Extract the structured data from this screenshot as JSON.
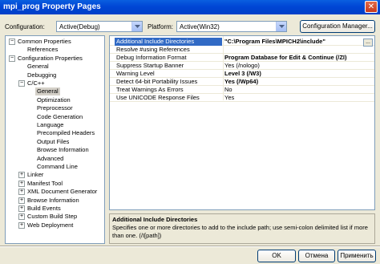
{
  "window": {
    "title": "mpi_prog Property Pages",
    "close_glyph": "✕"
  },
  "toolbar": {
    "configuration_label": "Configuration:",
    "configuration_value": "Active(Debug)",
    "platform_label": "Platform:",
    "platform_value": "Active(Win32)",
    "config_manager_label": "Configuration Manager..."
  },
  "tree": [
    {
      "label": "Common Properties",
      "toggle": "−"
    },
    {
      "label": "References"
    },
    {
      "label": "Configuration Properties",
      "toggle": "−"
    },
    {
      "label": "General"
    },
    {
      "label": "Debugging"
    },
    {
      "label": "C/C++",
      "toggle": "−"
    },
    {
      "label": "General",
      "selected": true
    },
    {
      "label": "Optimization"
    },
    {
      "label": "Preprocessor"
    },
    {
      "label": "Code Generation"
    },
    {
      "label": "Language"
    },
    {
      "label": "Precompiled Headers"
    },
    {
      "label": "Output Files"
    },
    {
      "label": "Browse Information"
    },
    {
      "label": "Advanced"
    },
    {
      "label": "Command Line"
    },
    {
      "label": "Linker",
      "toggle": "+"
    },
    {
      "label": "Manifest Tool",
      "toggle": "+"
    },
    {
      "label": "XML Document Generator",
      "toggle": "+"
    },
    {
      "label": "Browse Information",
      "toggle": "+"
    },
    {
      "label": "Build Events",
      "toggle": "+"
    },
    {
      "label": "Custom Build Step",
      "toggle": "+"
    },
    {
      "label": "Web Deployment",
      "toggle": "+"
    }
  ],
  "properties": [
    {
      "name": "Additional Include Directories",
      "value": "\"C:\\Program Files\\MPICH2\\include\"",
      "bold": true,
      "selected": true
    },
    {
      "name": "Resolve #using References",
      "value": ""
    },
    {
      "name": "Debug Information Format",
      "value": "Program Database for Edit & Continue (/ZI)",
      "bold": true
    },
    {
      "name": "Suppress Startup Banner",
      "value": "Yes (/nologo)"
    },
    {
      "name": "Warning Level",
      "value": "Level 3 (/W3)",
      "bold": true
    },
    {
      "name": "Detect 64-bit Portability Issues",
      "value": "Yes (/Wp64)",
      "bold": true
    },
    {
      "name": "Treat Warnings As Errors",
      "value": "No"
    },
    {
      "name": "Use UNICODE Response Files",
      "value": "Yes"
    }
  ],
  "property_ellipsis": "...",
  "description": {
    "title": "Additional Include Directories",
    "text": "Specifies one or more directories to add to the include path; use semi-colon delimited list if more than one. (/I[path])"
  },
  "buttons": {
    "ok": "OK",
    "cancel": "Отмена",
    "apply": "Применить"
  }
}
